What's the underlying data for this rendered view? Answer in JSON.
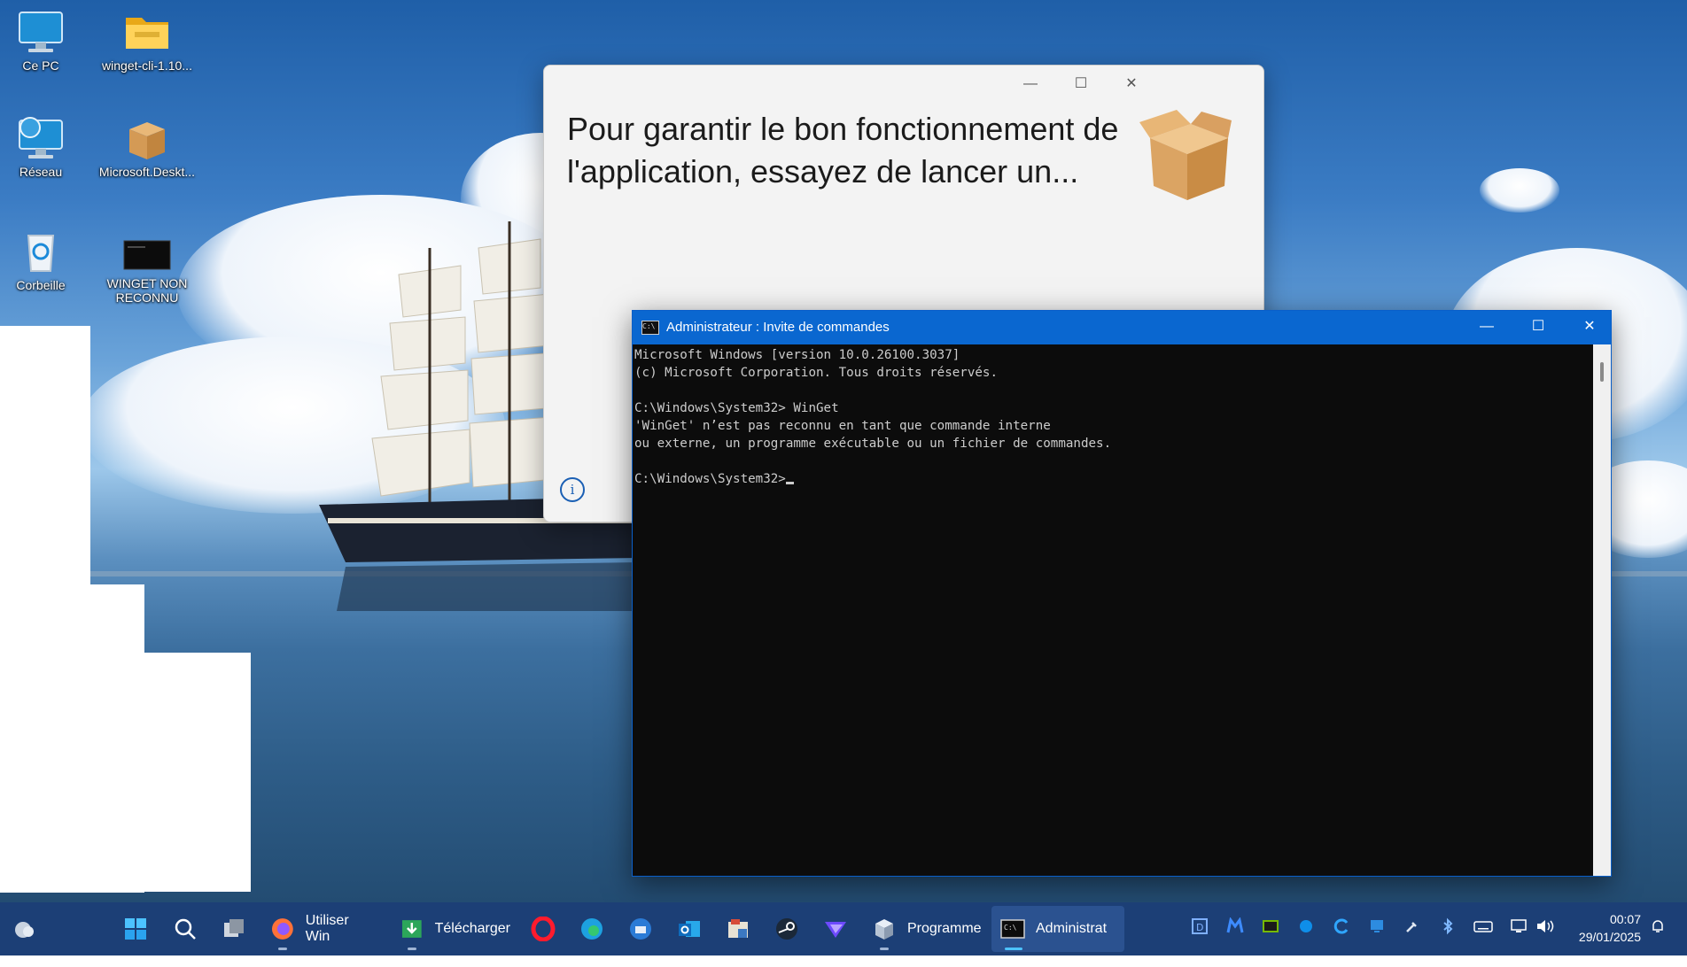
{
  "desktop": {
    "icons": [
      {
        "label": "Ce PC",
        "icon": "computer-icon"
      },
      {
        "label": "winget-cli-1.10...",
        "icon": "folder-icon"
      },
      {
        "label": "Réseau",
        "icon": "network-icon"
      },
      {
        "label": "Microsoft.Deskt...",
        "icon": "package-box-icon"
      },
      {
        "label": "Corbeille",
        "icon": "recycle-bin-icon"
      },
      {
        "label": "WINGET NON RECONNU",
        "icon": "console-shortcut-icon"
      }
    ]
  },
  "dialog": {
    "message": "Pour garantir le bon fonctionnement de l'application, essayez de lancer un...",
    "controls": {
      "minimize": "—",
      "maximize": "☐",
      "close": "✕"
    },
    "info_glyph": "i"
  },
  "cmd": {
    "title": "Administrateur : Invite de commandes",
    "controls": {
      "minimize": "—",
      "maximize": "☐",
      "close": "✕"
    },
    "lines": [
      "Microsoft Windows [version 10.0.26100.3037]",
      "(c) Microsoft Corporation. Tous droits réservés.",
      "",
      "C:\\Windows\\System32> WinGet",
      "'WinGet' n’est pas reconnu en tant que commande interne",
      "ou externe, un programme exécutable ou un fichier de commandes.",
      "",
      "C:\\Windows\\System32>"
    ]
  },
  "taskbar": {
    "apps": [
      {
        "name": "weather-icon"
      },
      {
        "name": "start-icon"
      },
      {
        "name": "search-icon"
      },
      {
        "name": "task-view-icon"
      },
      {
        "name": "firefox-icon",
        "label": "Utiliser Win"
      },
      {
        "name": "downloads-icon",
        "label": "Télécharger"
      },
      {
        "name": "opera-icon"
      },
      {
        "name": "edge-icon"
      },
      {
        "name": "thunderbird-icon"
      },
      {
        "name": "outlook-icon"
      },
      {
        "name": "file-manager-icon"
      },
      {
        "name": "steam-icon"
      },
      {
        "name": "proton-vpn-icon"
      },
      {
        "name": "installer-icon",
        "label": "Programme"
      },
      {
        "name": "cmd-icon",
        "label": "Administrat"
      }
    ],
    "tray": [
      "dashlane-icon",
      "malwarebytes-icon",
      "nvidia-icon",
      "teamviewer-icon",
      "cloud-sync-icon",
      "monitor-app-icon",
      "safely-remove-icon",
      "bluetooth-icon",
      "keyboard-icon",
      "network-icon",
      "volume-icon"
    ],
    "time": "00:07",
    "date": "29/01/2025",
    "notification_icon": "bell-icon"
  }
}
